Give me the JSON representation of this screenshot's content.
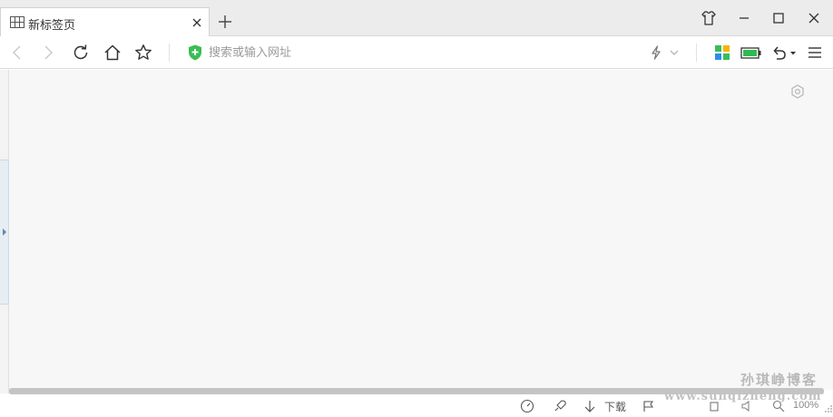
{
  "tab": {
    "title": "新标签页",
    "favicon_icon": "grid-icon",
    "close_icon": "close-icon"
  },
  "new_tab_icon": "plus-icon",
  "window_controls": {
    "skin_icon": "tshirt-icon",
    "minimize_icon": "minimize-icon",
    "maximize_icon": "maximize-icon",
    "close_icon": "close-icon"
  },
  "address_bar": {
    "placeholder": "搜索或输入网址",
    "value": "",
    "security_icon": "shield-icon"
  },
  "toolbar_icons": {
    "back": "back-arrow-icon",
    "forward": "forward-arrow-icon",
    "reload": "reload-icon",
    "home": "home-icon",
    "favorite": "star-icon",
    "speed": "lightning-icon",
    "apps": "apps-grid-icon",
    "battery": "battery-icon",
    "undo": "undo-icon",
    "menu": "menu-icon"
  },
  "status_bar": {
    "download_label": "下载",
    "zoom": "100%",
    "watermark_cn": "孙琪峥博客",
    "watermark_url": "www.sunqizheng.com"
  },
  "colors": {
    "accent_green": "#3bbd57",
    "tabbar_bg": "#ececec",
    "content_bg": "#f7f7f7",
    "battery_green": "#2dbb4f"
  }
}
